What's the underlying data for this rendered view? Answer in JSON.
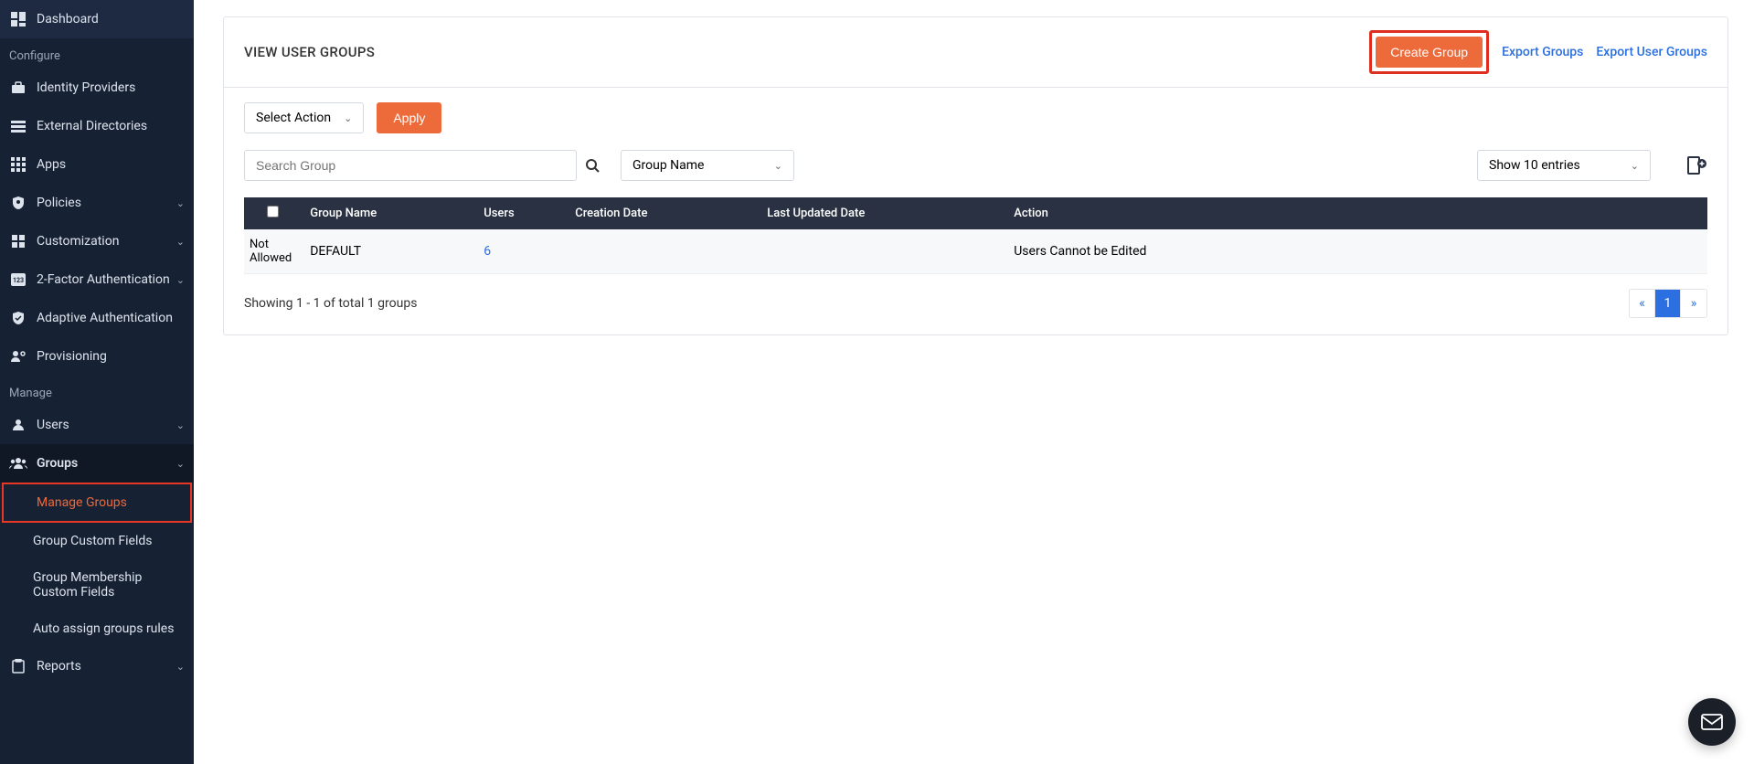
{
  "sidebar": {
    "dashboard": "Dashboard",
    "sections": {
      "configure": "Configure",
      "manage": "Manage"
    },
    "items": {
      "identity_providers": "Identity Providers",
      "external_directories": "External Directories",
      "apps": "Apps",
      "policies": "Policies",
      "customization": "Customization",
      "two_factor": "2-Factor Authentication",
      "adaptive_auth": "Adaptive Authentication",
      "provisioning": "Provisioning",
      "users": "Users",
      "groups": "Groups",
      "reports": "Reports"
    },
    "groups_sub": {
      "manage_groups": "Manage Groups",
      "custom_fields": "Group Custom Fields",
      "membership_fields": "Group Membership Custom Fields",
      "auto_assign": "Auto assign groups rules"
    }
  },
  "panel": {
    "title": "VIEW USER GROUPS",
    "create_group": "Create Group",
    "export_groups": "Export Groups",
    "export_user_groups": "Export User Groups"
  },
  "controls": {
    "select_action": "Select Action",
    "apply": "Apply",
    "search_placeholder": "Search Group",
    "filter_by": "Group Name",
    "show_entries": "Show 10 entries"
  },
  "table": {
    "headers": {
      "group_name": "Group Name",
      "users": "Users",
      "creation_date": "Creation Date",
      "last_updated": "Last Updated Date",
      "action": "Action"
    },
    "rows": [
      {
        "checkbox": "Not Allowed",
        "group_name": "DEFAULT",
        "users": "6",
        "creation_date": "",
        "last_updated": "",
        "action": "Users Cannot be Edited"
      }
    ],
    "footer_text": "Showing 1 - 1 of total 1 groups",
    "pagination": {
      "prev": "«",
      "current": "1",
      "next": "»"
    }
  }
}
